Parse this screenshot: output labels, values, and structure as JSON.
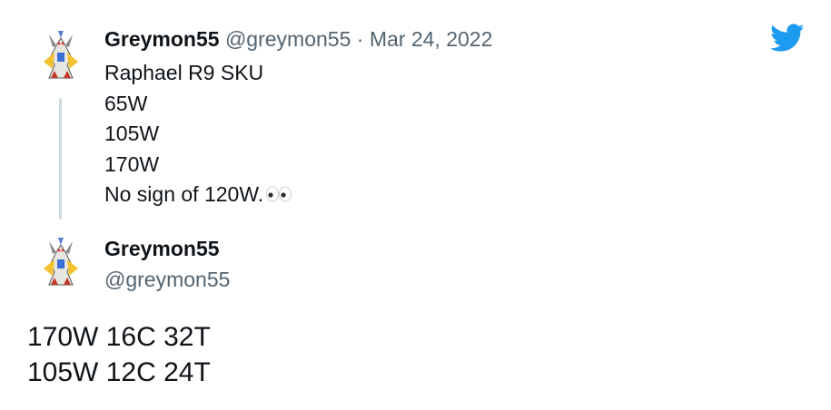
{
  "quoted_tweet": {
    "author_name": "Greymon55",
    "author_handle": "@greymon55",
    "separator": " · ",
    "date": "Mar 24, 2022",
    "lines": [
      "Raphael R9 SKU",
      "65W",
      "105W",
      "170W",
      "No sign of 120W."
    ],
    "emoji": "eyes-icon"
  },
  "tweet": {
    "author_name": "Greymon55",
    "author_handle": "@greymon55",
    "lines": [
      "170W 16C 32T",
      "105W 12C 24T"
    ]
  },
  "brand": {
    "icon": "twitter-bird-icon",
    "color": "#1d9bf0"
  },
  "colors": {
    "text_primary": "#0f1419",
    "text_secondary": "#536471",
    "thread_line": "#cfd9de"
  }
}
